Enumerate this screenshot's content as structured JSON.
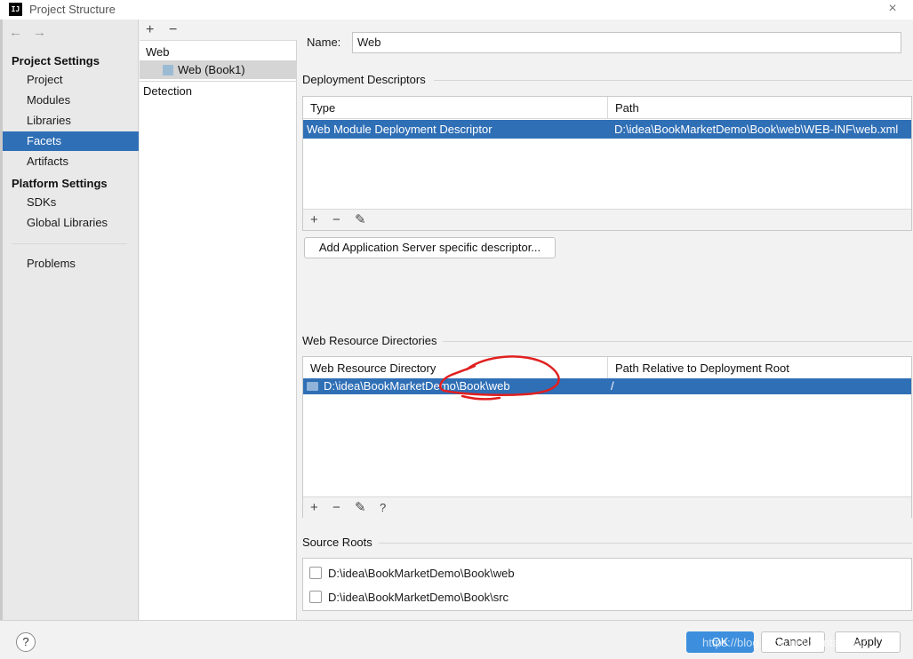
{
  "window": {
    "title": "Project Structure",
    "app_icon": "IJ",
    "close_glyph": "×"
  },
  "nav": {
    "back": "←",
    "forward": "→",
    "project_settings": "Project Settings",
    "project_items": [
      "Project",
      "Modules",
      "Libraries",
      "Facets",
      "Artifacts"
    ],
    "selected": "Facets",
    "platform_settings": "Platform Settings",
    "platform_items": [
      "SDKs",
      "Global Libraries"
    ],
    "problems": "Problems"
  },
  "facets": {
    "add": "+",
    "remove": "−",
    "group": "Web",
    "item": "Web (Book1)",
    "detection": "Detection"
  },
  "form": {
    "name_label": "Name:",
    "name_value": "Web",
    "deployment": {
      "title": "Deployment Descriptors",
      "columns": [
        "Type",
        "Path"
      ],
      "rows": [
        {
          "type": "Web Module Deployment Descriptor",
          "path": "D:\\idea\\BookMarketDemo\\Book\\web\\WEB-INF\\web.xml"
        }
      ],
      "tools": [
        "+",
        "−",
        "✎"
      ],
      "add_server_button": "Add Application Server specific descriptor..."
    },
    "resources": {
      "title": "Web Resource Directories",
      "columns": [
        "Web Resource Directory",
        "Path Relative to Deployment Root"
      ],
      "rows": [
        {
          "dir": "D:\\idea\\BookMarketDemo\\Book\\web",
          "relpath": "/"
        }
      ],
      "tools": [
        "+",
        "−",
        "✎",
        "?"
      ],
      "annotation_color": "#e02020"
    },
    "sources": {
      "title": "Source Roots",
      "items": [
        {
          "label": "D:\\idea\\BookMarketDemo\\Book\\web",
          "checked": false
        },
        {
          "label": "D:\\idea\\BookMarketDemo\\Book\\src",
          "checked": false
        }
      ]
    }
  },
  "footer": {
    "help": "?",
    "ok": "OK",
    "cancel": "Cancel",
    "apply": "Apply",
    "watermark": "https://blog.csdn.net/Santa_Wan"
  },
  "colors": {
    "selection": "#2f6fb6",
    "primary_button": "#3d8fde"
  }
}
